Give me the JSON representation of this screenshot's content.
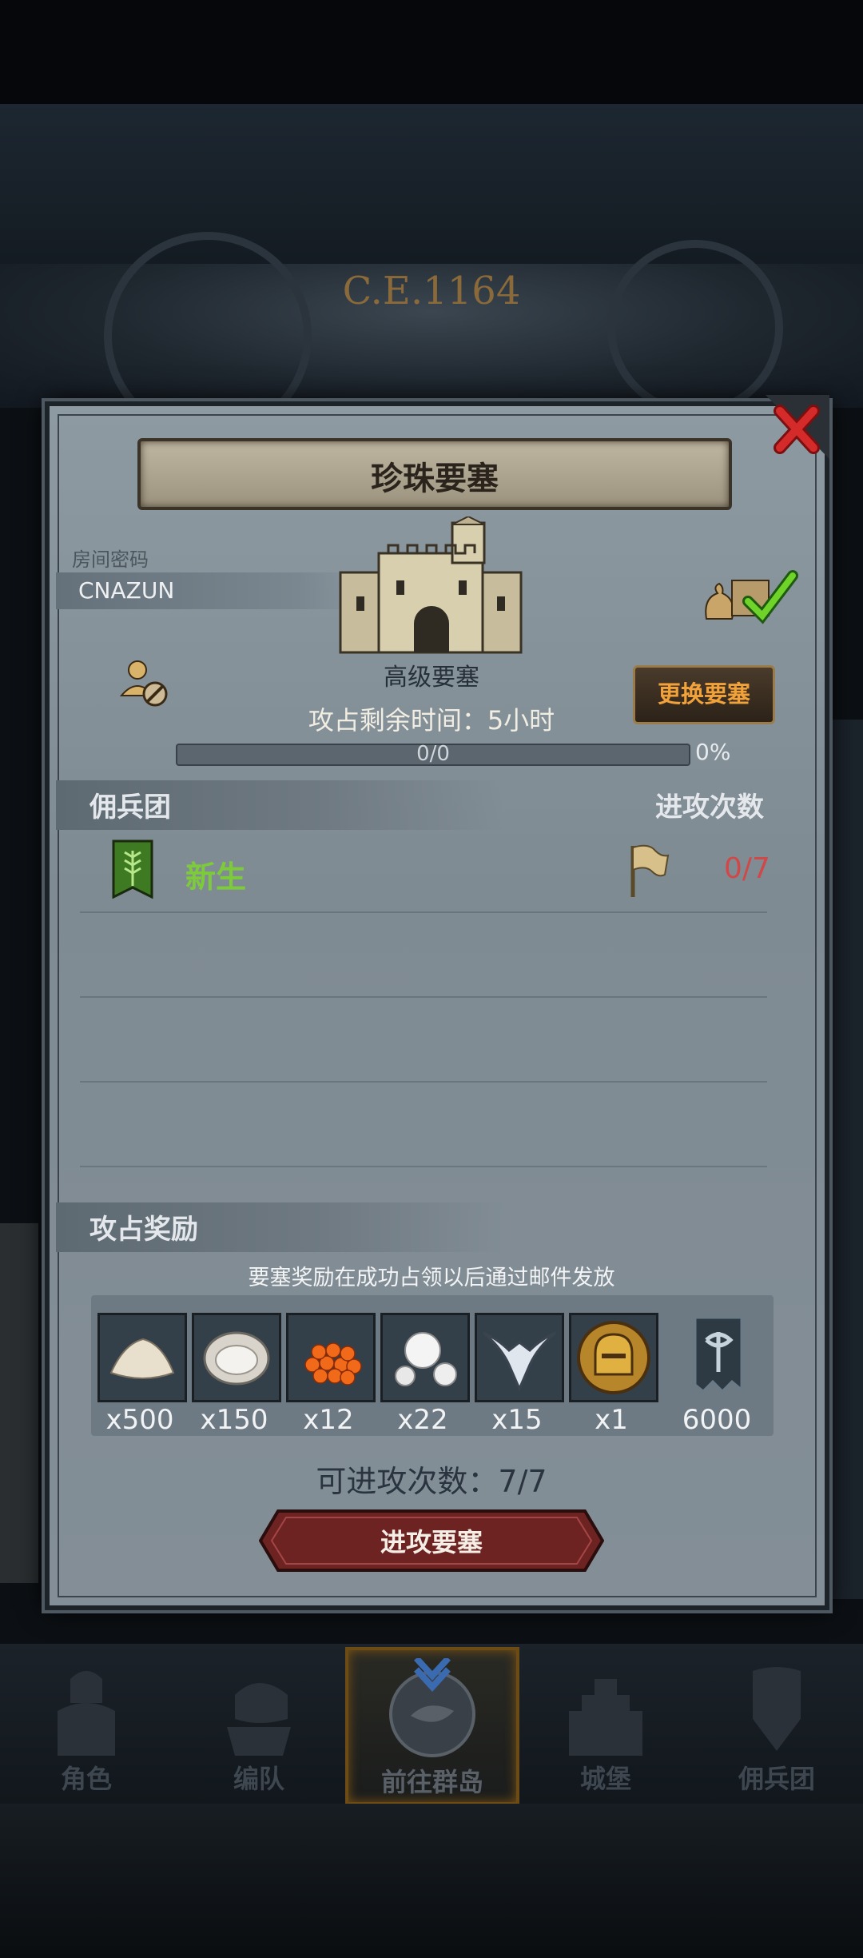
{
  "background": {
    "era_label": "C.E.1164"
  },
  "dialog": {
    "title": "珍珠要塞",
    "room_code_label": "房间密码",
    "room_code": "CNAZUN",
    "fortress_level": "高级要塞",
    "time_remaining": "攻占剩余时间：5小时",
    "swap_button": "更换要塞",
    "progress_text": "0/0",
    "progress_percent_text": "0%",
    "progress_value": 0,
    "mercenary_header": "佣兵团",
    "attacks_header": "进攻次数",
    "mercenaries": [
      {
        "name": "新生",
        "attacks": "0/7"
      }
    ],
    "rewards_header": "攻占奖励",
    "rewards_hint": "要塞奖励在成功占领以后通过邮件发放",
    "rewards": [
      {
        "icon": "sand-pile-icon",
        "quantity": "x500"
      },
      {
        "icon": "oyster-icon",
        "quantity": "x150"
      },
      {
        "icon": "fish-roe-icon",
        "quantity": "x12"
      },
      {
        "icon": "pearls-icon",
        "quantity": "x22"
      },
      {
        "icon": "winged-helm-icon",
        "quantity": "x15"
      },
      {
        "icon": "knight-helmet-coin-icon",
        "quantity": "x1"
      },
      {
        "icon": "guild-banner-icon",
        "quantity": "6000"
      }
    ],
    "available_attacks": "可进攻次数：7/7",
    "attack_button": "进攻要塞"
  },
  "bottom_nav": {
    "items": [
      {
        "label": "角色",
        "icon": "character-icon",
        "active": false
      },
      {
        "label": "编队",
        "icon": "formation-icon",
        "active": false
      },
      {
        "label": "前往群岛",
        "icon": "islands-icon",
        "active": true
      },
      {
        "label": "城堡",
        "icon": "castle-icon",
        "active": false
      },
      {
        "label": "佣兵团",
        "icon": "mercenary-icon",
        "active": false
      }
    ]
  },
  "colors": {
    "accent_gold": "#f2a23a",
    "mercenary_green": "#7dcb3a",
    "attack_count_red": "#d04848",
    "attack_button": "#7a2a2a"
  }
}
